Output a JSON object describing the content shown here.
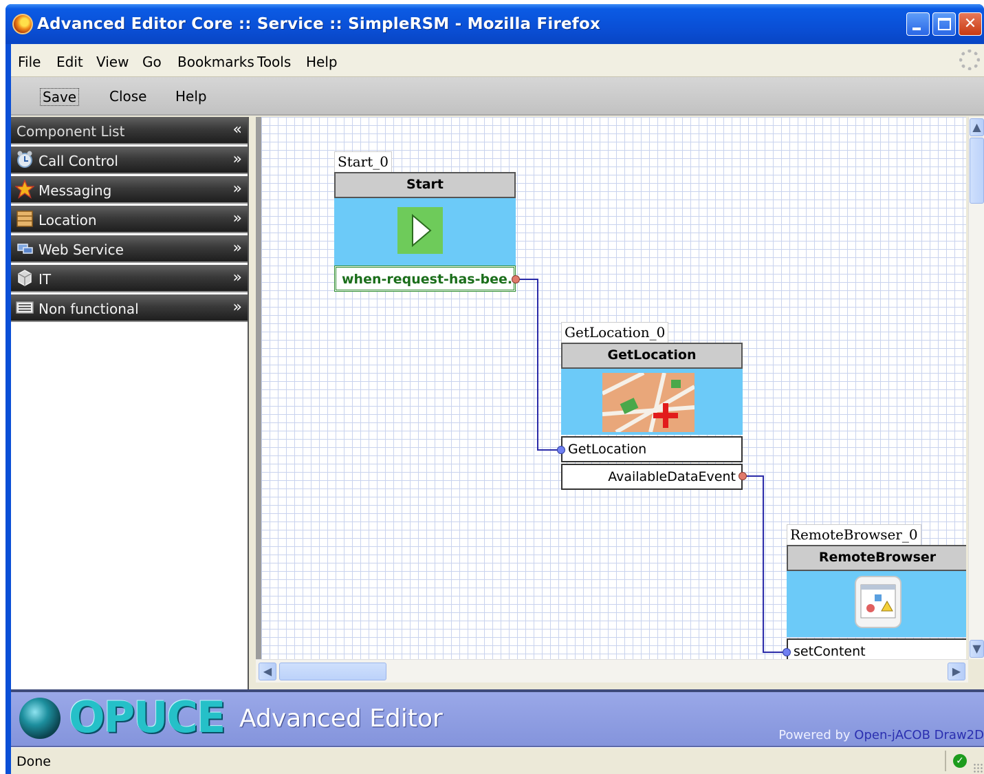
{
  "window": {
    "title": "Advanced Editor Core :: Service :: SimpleRSM - Mozilla Firefox",
    "icon": "firefox-icon"
  },
  "menubar": {
    "items": [
      "File",
      "Edit",
      "View",
      "Go",
      "Bookmarks",
      "Tools",
      "Help"
    ]
  },
  "toolbar": {
    "save_label": "Save",
    "close_label": "Close",
    "help_label": "Help"
  },
  "left_panel": {
    "header": "Component List",
    "header_chevron": "«",
    "categories": [
      {
        "label": "Call Control",
        "icon": "alarm-clock-icon",
        "chevron": "»"
      },
      {
        "label": "Messaging",
        "icon": "star-icon",
        "chevron": "»"
      },
      {
        "label": "Location",
        "icon": "map-icon",
        "chevron": "»"
      },
      {
        "label": "Web Service",
        "icon": "network-icon",
        "chevron": "»"
      },
      {
        "label": "IT",
        "icon": "server-icon",
        "chevron": "»"
      },
      {
        "label": "Non functional",
        "icon": "keyboard-icon",
        "chevron": "»"
      }
    ]
  },
  "canvas": {
    "components": {
      "start": {
        "instance_name": "Start_0",
        "title": "Start",
        "icon": "play-icon",
        "output": "when-request-has-bee..."
      },
      "getlocation": {
        "instance_name": "GetLocation_0",
        "title": "GetLocation",
        "icon": "street-map-icon",
        "input": "GetLocation",
        "output": "AvailableDataEvent"
      },
      "remotebrowser": {
        "instance_name": "RemoteBrowser_0",
        "title": "RemoteBrowser",
        "icon": "browser-window-icon",
        "input": "setContent"
      }
    },
    "colors": {
      "connection": "#2a2aa8",
      "output_port": "#e07a6b",
      "input_port": "#6f7ff2",
      "component_body": "#6ccaf8"
    }
  },
  "banner": {
    "logo_text": "OPUCE",
    "title": "Advanced Editor",
    "powered_prefix": "Powered by ",
    "powered_link": "Open-jACOB Draw2D"
  },
  "statusbar": {
    "text": "Done"
  }
}
